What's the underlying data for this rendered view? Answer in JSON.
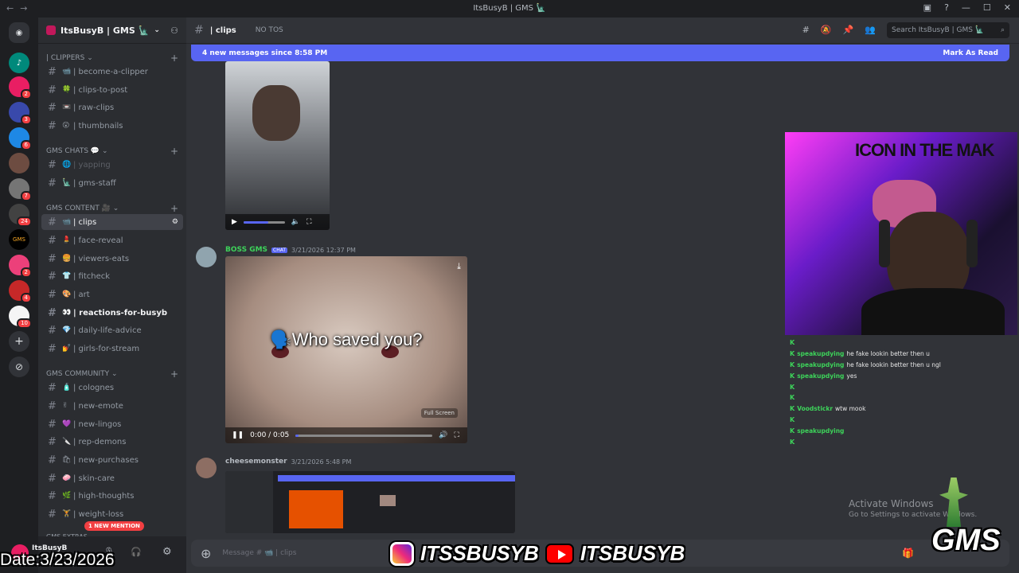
{
  "window": {
    "title": "ItsBusyB | GMS 🗽"
  },
  "servers": [
    {
      "badge": ""
    },
    {
      "badge": "2"
    },
    {
      "badge": "3"
    },
    {
      "badge": "6"
    },
    {
      "badge": ""
    },
    {
      "badge": "7"
    },
    {
      "badge": "24"
    },
    {
      "badge": ""
    },
    {
      "badge": "2"
    },
    {
      "badge": "4"
    },
    {
      "badge": "10"
    }
  ],
  "sidebar": {
    "guild_name": "ItsBusyB | GMS 🗽",
    "categories": [
      {
        "label": "| CLIPPERS ⌄"
      },
      {
        "label": "GMS CHATS 💬 ⌄"
      },
      {
        "label": "GMS CONTENT 🎥 ⌄"
      },
      {
        "label": "GMS COMMUNITY ⌄"
      },
      {
        "label": "GMS EXTRAS"
      }
    ],
    "channels": [
      {
        "emoji": "📹",
        "label": "| become-a-clipper"
      },
      {
        "emoji": "🍀",
        "label": "| clips-to-post"
      },
      {
        "emoji": "📼",
        "label": "| raw-clips"
      },
      {
        "emoji": "😲",
        "label": "| thumbnails"
      },
      {
        "emoji": "🌐",
        "label": "| yapping"
      },
      {
        "emoji": "🗽",
        "label": "| gms-staff"
      },
      {
        "emoji": "📹",
        "label": "| clips"
      },
      {
        "emoji": "💄",
        "label": "| face-reveal"
      },
      {
        "emoji": "🍔",
        "label": "| viewers-eats"
      },
      {
        "emoji": "👕",
        "label": "| fitcheck"
      },
      {
        "emoji": "🎨",
        "label": "| art"
      },
      {
        "emoji": "👀",
        "label": "| reactions-for-busyb"
      },
      {
        "emoji": "💎",
        "label": "| daily-life-advice"
      },
      {
        "emoji": "💅",
        "label": "| girls-for-stream"
      },
      {
        "emoji": "🧴",
        "label": "| colognes"
      },
      {
        "emoji": "✌",
        "label": "| new-emote"
      },
      {
        "emoji": "💜",
        "label": "| new-lingos"
      },
      {
        "emoji": "🔪",
        "label": "| rep-demons"
      },
      {
        "emoji": "🛍",
        "label": "| new-purchases"
      },
      {
        "emoji": "🧼",
        "label": "| skin-care"
      },
      {
        "emoji": "🌿",
        "label": "| high-thoughts"
      },
      {
        "emoji": "🏋",
        "label": "| weight-loss"
      }
    ],
    "mention_pill": "1 NEW MENTION",
    "user": {
      "name": "ItsBusyB"
    }
  },
  "header": {
    "channel": "| clips",
    "topic": "NO TOS",
    "search_placeholder": "Search ItsBusyB | GMS 🗽"
  },
  "new_messages": {
    "text": "4 new messages since 8:58 PM",
    "action": "Mark As Read"
  },
  "messages": [
    {
      "author": "BOSS GMS",
      "tag": "CHAT",
      "time": "3/21/2026 12:37 PM",
      "video_caption": "🗣️Who saved you?",
      "video_time": "0:00 / 0:05",
      "progress": 0.02,
      "tooltip": "Full Screen"
    },
    {
      "author": "cheesemonster",
      "time": "3/21/2026 5:48 PM"
    }
  ],
  "first_video_progress": 0.6,
  "composer": {
    "placeholder": "Message # 📹 | clips"
  },
  "stream_overlay": {
    "webcam_sign": "ICON IN THE MAK",
    "chat": [
      {
        "user": "",
        "message": "",
        "color": "#e53935"
      },
      {
        "user": "speakupdying",
        "message": "he fake lookin better then u",
        "color": "#3dd35a"
      },
      {
        "user": "speakupdying",
        "message": "he fake lookin better then u ngl",
        "color": "#3dd35a"
      },
      {
        "user": "speakupdying",
        "message": "yes",
        "color": "#3dd35a"
      },
      {
        "user": "",
        "message": "",
        "color": "#e53935"
      },
      {
        "user": "",
        "message": "",
        "color": "#e53935"
      },
      {
        "user": "Voodstickr",
        "message": "wtw mook",
        "color": "#3dd35a"
      },
      {
        "user": "",
        "message": "",
        "color": "#e53935"
      },
      {
        "user": "speakupdying",
        "message": "",
        "color": "#3dd35a"
      },
      {
        "user": "",
        "message": "",
        "color": "#e53935"
      }
    ],
    "activate_title": "Activate Windows",
    "activate_sub": "Go to Settings to activate Windows.",
    "social_handle_1": "ITSSBUSYB",
    "social_handle_2": "ITSBUSYB",
    "brand": "GMS",
    "date_stamp": "Date:3/23/2026"
  }
}
